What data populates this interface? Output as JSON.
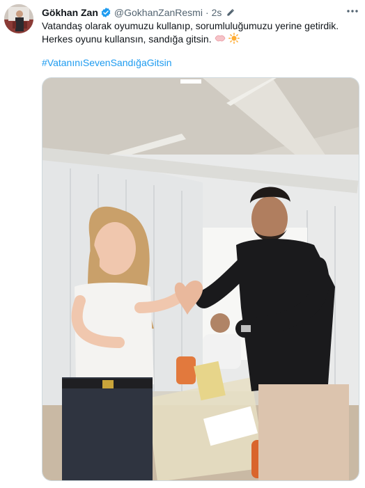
{
  "tweet": {
    "author_name": "Gökhan Zan",
    "author_handle": "@GokhanZanResmi",
    "separator": "·",
    "timestamp": "2s",
    "text_line_1": "Vatandaş olarak oyumuzu kullanıp, sorumluluğumuzu yerine getirdik.",
    "text_line_2": "Herkes oyunu kullansın, sandığa gitsin.",
    "hashtag": "#VatanınıSevenSandığaGitsin",
    "emojis": [
      "handshake-hands-emoji",
      "sun-emoji"
    ],
    "icons": {
      "verified": "verified-badge-icon",
      "edit": "edit-pencil-icon",
      "more": "more-options-icon"
    },
    "colors": {
      "link": "#1d9bf0",
      "verified": "#1d9bf0",
      "secondary_text": "#536471"
    }
  }
}
